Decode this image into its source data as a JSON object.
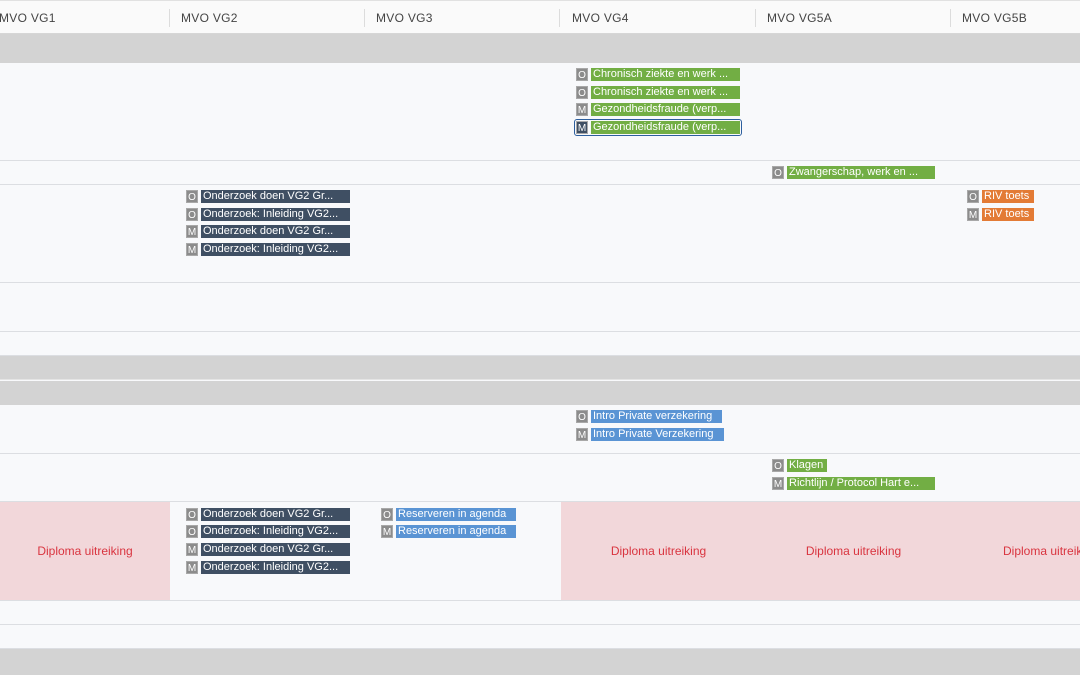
{
  "columns": [
    {
      "id": "vg1",
      "label": "MVO VG1"
    },
    {
      "id": "vg2",
      "label": "MVO VG2"
    },
    {
      "id": "vg3",
      "label": "MVO VG3"
    },
    {
      "id": "vg4",
      "label": "MVO VG4"
    },
    {
      "id": "vg5a",
      "label": "MVO VG5A"
    },
    {
      "id": "vg5b",
      "label": "MVO VG5B"
    }
  ],
  "events": {
    "vg4_row1": [
      {
        "badge": "O",
        "label": "Chronisch ziekte en werk ...",
        "color": "green"
      },
      {
        "badge": "O",
        "label": "Chronisch ziekte en werk ...",
        "color": "green"
      },
      {
        "badge": "M",
        "label": "Gezondheidsfraude (verp...",
        "color": "green"
      },
      {
        "badge": "M",
        "label": "Gezondheidsfraude (verp...",
        "color": "green",
        "selected": true
      }
    ],
    "vg5a_row2": [
      {
        "badge": "O",
        "label": "Zwangerschap, werk en ...",
        "color": "green"
      }
    ],
    "vg2_row3": [
      {
        "badge": "O",
        "label": "Onderzoek doen VG2 Gr...",
        "color": "dark"
      },
      {
        "badge": "O",
        "label": "Onderzoek: Inleiding VG2...",
        "color": "dark"
      },
      {
        "badge": "M",
        "label": "Onderzoek doen VG2 Gr...",
        "color": "dark"
      },
      {
        "badge": "M",
        "label": "Onderzoek: Inleiding VG2...",
        "color": "dark"
      }
    ],
    "vg5b_row3": [
      {
        "badge": "O",
        "label": "RIV toets",
        "color": "orange"
      },
      {
        "badge": "M",
        "label": "RIV toets",
        "color": "orange"
      }
    ],
    "vg4_row6": [
      {
        "badge": "O",
        "label": "Intro Private verzekering",
        "color": "blue"
      },
      {
        "badge": "M",
        "label": "Intro Private Verzekering",
        "color": "blue"
      }
    ],
    "vg5a_row7": [
      {
        "badge": "O",
        "label": "Klagen",
        "color": "green"
      },
      {
        "badge": "M",
        "label": "Richtlijn / Protocol Hart e...",
        "color": "green"
      }
    ],
    "vg2_row8": [
      {
        "badge": "O",
        "label": "Onderzoek doen VG2 Gr...",
        "color": "dark"
      },
      {
        "badge": "O",
        "label": "Onderzoek: Inleiding VG2...",
        "color": "dark"
      },
      {
        "badge": "M",
        "label": "Onderzoek doen VG2 Gr...",
        "color": "dark"
      },
      {
        "badge": "M",
        "label": "Onderzoek: Inleiding VG2...",
        "color": "dark"
      }
    ],
    "vg3_row8": [
      {
        "badge": "O",
        "label": "Reserveren in agenda",
        "color": "blue"
      },
      {
        "badge": "M",
        "label": "Reserveren in agenda",
        "color": "blue"
      }
    ]
  },
  "diploma": {
    "label": "Diploma uitreiking"
  },
  "colors": {
    "dark": "#3f4f63",
    "green": "#72ae44",
    "orange": "#e37b35",
    "blue": "#5a94d4",
    "pink_bg": "#f2d7da",
    "pink_text": "#d9343f",
    "gray_band": "#d3d3d3"
  }
}
